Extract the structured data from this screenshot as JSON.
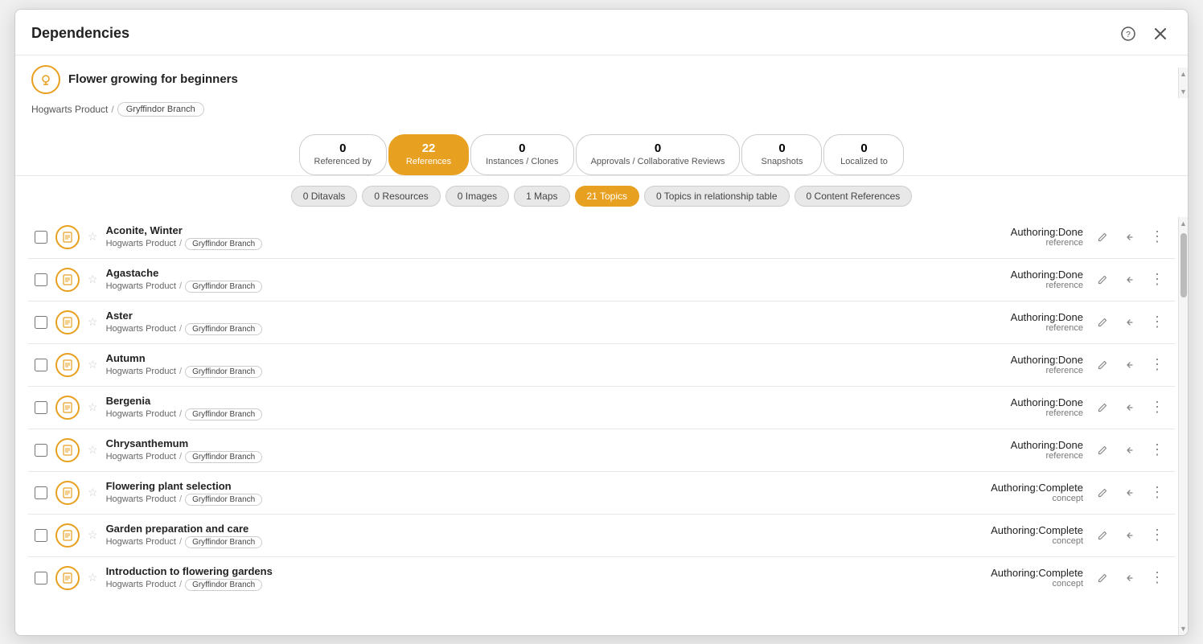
{
  "modal": {
    "title": "Dependencies",
    "help_icon": "?",
    "close_icon": "✕"
  },
  "document": {
    "title": "Flower growing for beginners",
    "icon_symbol": "☻",
    "breadcrumb_prefix": "Hogwarts Product",
    "breadcrumb_sep": "/",
    "branch": "Gryffindor Branch"
  },
  "tabs": [
    {
      "count": "0",
      "label": "Referenced by",
      "active": false
    },
    {
      "count": "22",
      "label": "References",
      "active": true
    },
    {
      "count": "0",
      "label": "Instances / Clones",
      "active": false
    },
    {
      "count": "0",
      "label": "Approvals / Collaborative Reviews",
      "active": false
    },
    {
      "count": "0",
      "label": "Snapshots",
      "active": false
    },
    {
      "count": "0",
      "label": "Localized to",
      "active": false
    }
  ],
  "filter_tabs": [
    {
      "label": "0 Ditavals",
      "active": false
    },
    {
      "label": "0 Resources",
      "active": false
    },
    {
      "label": "0 Images",
      "active": false
    },
    {
      "label": "1 Maps",
      "active": false
    },
    {
      "label": "21 Topics",
      "active": true
    },
    {
      "label": "0 Topics in relationship table",
      "active": false
    },
    {
      "label": "0 Content References",
      "active": false
    }
  ],
  "items": [
    {
      "name": "Aconite, Winter",
      "path_prefix": "Hogwarts Product",
      "branch": "Gryffindor Branch",
      "status": "Authoring:Done",
      "type": "reference"
    },
    {
      "name": "Agastache",
      "path_prefix": "Hogwarts Product",
      "branch": "Gryffindor Branch",
      "status": "Authoring:Done",
      "type": "reference"
    },
    {
      "name": "Aster",
      "path_prefix": "Hogwarts Product",
      "branch": "Gryffindor Branch",
      "status": "Authoring:Done",
      "type": "reference"
    },
    {
      "name": "Autumn",
      "path_prefix": "Hogwarts Product",
      "branch": "Gryffindor Branch",
      "status": "Authoring:Done",
      "type": "reference"
    },
    {
      "name": "Bergenia",
      "path_prefix": "Hogwarts Product",
      "branch": "Gryffindor Branch",
      "status": "Authoring:Done",
      "type": "reference"
    },
    {
      "name": "Chrysanthemum",
      "path_prefix": "Hogwarts Product",
      "branch": "Gryffindor Branch",
      "status": "Authoring:Done",
      "type": "reference"
    },
    {
      "name": "Flowering plant selection",
      "path_prefix": "Hogwarts Product",
      "branch": "Gryffindor Branch",
      "status": "Authoring:Complete",
      "type": "concept"
    },
    {
      "name": "Garden preparation and care",
      "path_prefix": "Hogwarts Product",
      "branch": "Gryffindor Branch",
      "status": "Authoring:Complete",
      "type": "concept"
    },
    {
      "name": "Introduction to flowering gardens",
      "path_prefix": "Hogwarts Product",
      "branch": "Gryffindor Branch",
      "status": "Authoring:Complete",
      "type": "concept"
    }
  ],
  "icons": {
    "edit": "✎",
    "back_arrow": "←",
    "more": "⋮",
    "star_empty": "☆",
    "doc": "≡"
  }
}
